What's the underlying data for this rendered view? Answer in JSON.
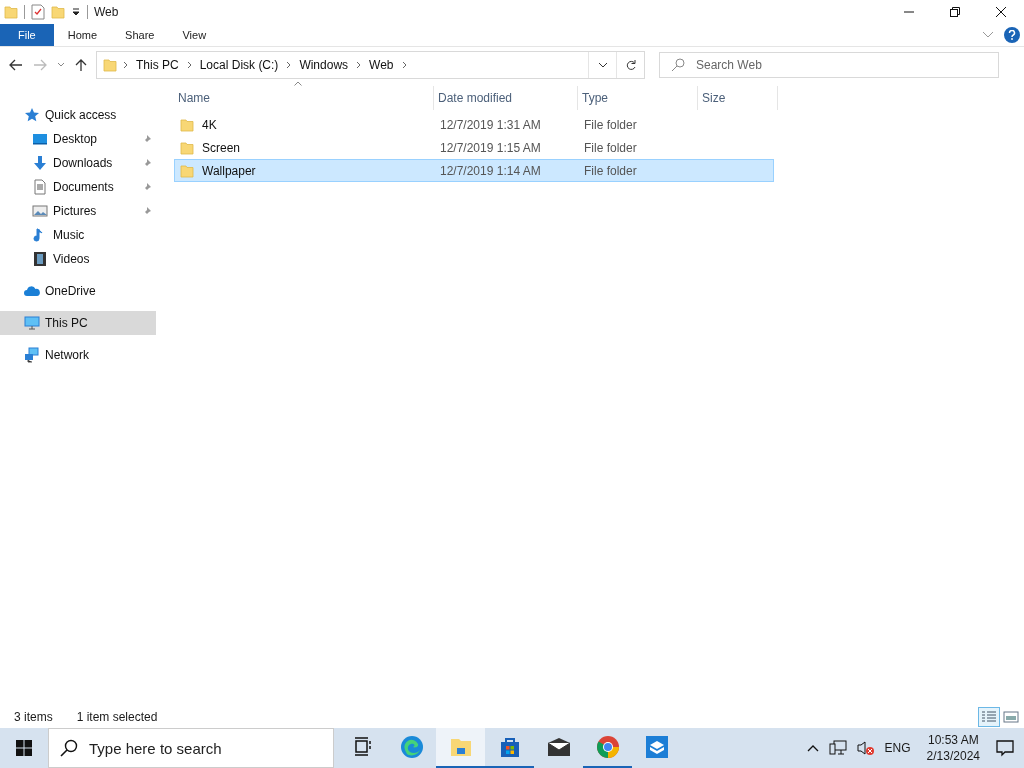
{
  "window": {
    "title": "Web"
  },
  "ribbon_tabs": [
    {
      "label": "File",
      "selected": true
    },
    {
      "label": "Home",
      "selected": false
    },
    {
      "label": "Share",
      "selected": false
    },
    {
      "label": "View",
      "selected": false
    }
  ],
  "breadcrumb": [
    "This PC",
    "Local Disk (C:)",
    "Windows",
    "Web"
  ],
  "search": {
    "placeholder": "Search Web"
  },
  "sidebar": {
    "items": [
      {
        "label": "Quick access",
        "kind": "star",
        "selected": false,
        "children": [
          {
            "label": "Desktop",
            "kind": "desktop",
            "pinned": true,
            "selected": false
          },
          {
            "label": "Downloads",
            "kind": "download",
            "pinned": true,
            "selected": false
          },
          {
            "label": "Documents",
            "kind": "document",
            "pinned": true,
            "selected": false
          },
          {
            "label": "Pictures",
            "kind": "picture",
            "pinned": true,
            "selected": false
          },
          {
            "label": "Music",
            "kind": "music",
            "pinned": false,
            "selected": false
          },
          {
            "label": "Videos",
            "kind": "video",
            "pinned": false,
            "selected": false
          }
        ]
      },
      {
        "label": "OneDrive",
        "kind": "cloud",
        "selected": false
      },
      {
        "label": "This PC",
        "kind": "pc",
        "selected": true
      },
      {
        "label": "Network",
        "kind": "network",
        "selected": false
      }
    ]
  },
  "table": {
    "columns": [
      "Name",
      "Date modified",
      "Type",
      "Size"
    ],
    "rows": [
      {
        "name": "4K",
        "date": "12/7/2019 1:31 AM",
        "type": "File folder",
        "selected": false
      },
      {
        "name": "Screen",
        "date": "12/7/2019 1:15 AM",
        "type": "File folder",
        "selected": false
      },
      {
        "name": "Wallpaper",
        "date": "12/7/2019 1:14 AM",
        "type": "File folder",
        "selected": true
      }
    ]
  },
  "status_bar": {
    "count": "3 items",
    "selection": "1 item selected",
    "views": [
      {
        "kind": "details",
        "selected": true
      },
      {
        "kind": "tiles",
        "selected": false
      }
    ]
  },
  "taskbar": {
    "search_placeholder": "Type here to search",
    "apps": [
      {
        "kind": "taskview",
        "open": false,
        "selected": false
      },
      {
        "kind": "edge",
        "open": false,
        "selected": false
      },
      {
        "kind": "explorer",
        "open": true,
        "selected": true
      },
      {
        "kind": "store",
        "open": true,
        "selected": false
      },
      {
        "kind": "mail",
        "open": false,
        "selected": false
      },
      {
        "kind": "chrome",
        "open": true,
        "selected": false
      },
      {
        "kind": "sandbox",
        "open": false,
        "selected": false
      }
    ],
    "language": "ENG",
    "time": "10:53 AM",
    "date": "2/13/2024"
  }
}
